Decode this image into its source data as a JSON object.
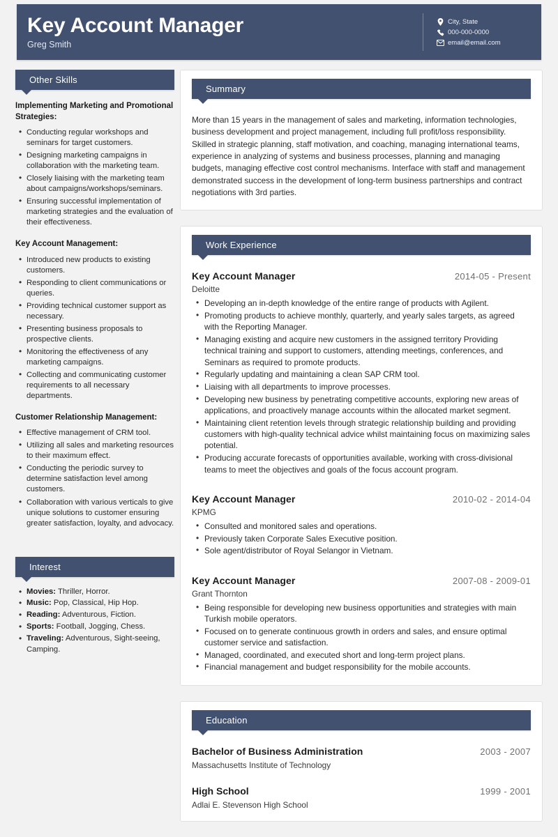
{
  "theme": {
    "accent": "#41516f",
    "page_bg": "#f2f2f2",
    "card_bg": "#ffffff"
  },
  "header": {
    "title": "Key Account Manager",
    "name": "Greg Smith",
    "contacts": [
      {
        "icon": "location-pin-icon",
        "text": "City, State"
      },
      {
        "icon": "phone-icon",
        "text": "000-000-0000"
      },
      {
        "icon": "envelope-icon",
        "text": "email@email.com"
      }
    ]
  },
  "sidebar": {
    "skills": {
      "heading": "Other Skills",
      "groups": [
        {
          "title": "Implementing Marketing and Promotional Strategies:",
          "items": [
            "Conducting regular workshops and seminars for target customers.",
            "Designing marketing campaigns in collaboration with the marketing team.",
            "Closely liaising with the marketing team about campaigns/workshops/seminars.",
            "Ensuring successful implementation of marketing strategies and the evaluation of their effectiveness."
          ]
        },
        {
          "title": "Key Account Management:",
          "items": [
            "Introduced new products to existing customers.",
            "Responding to client communications or queries.",
            "Providing technical customer support as necessary.",
            "Presenting business proposals to prospective clients.",
            "Monitoring the effectiveness of any marketing campaigns.",
            "Collecting and communicating customer requirements to all necessary departments."
          ]
        },
        {
          "title": "Customer Relationship Management:",
          "items": [
            "Effective management of CRM tool.",
            "Utilizing all sales and marketing resources to their maximum effect.",
            "Conducting the periodic survey to determine satisfaction level among customers.",
            "Collaboration with various verticals to give unique solutions to customer ensuring greater satisfaction, loyalty, and advocacy."
          ]
        }
      ]
    },
    "interest": {
      "heading": "Interest",
      "items": [
        {
          "label": "Movies:",
          "value": " Thriller, Horror."
        },
        {
          "label": "Music:",
          "value": " Pop, Classical, Hip Hop."
        },
        {
          "label": "Reading:",
          "value": " Adventurous, Fiction."
        },
        {
          "label": "Sports:",
          "value": " Football, Jogging, Chess."
        },
        {
          "label": "Traveling:",
          "value": " Adventurous, Sight-seeing, Camping."
        }
      ]
    }
  },
  "main": {
    "summary": {
      "heading": "Summary",
      "text": "More than 15 years in the management of sales and marketing, information technologies, business development and project management, including full profit/loss responsibility. Skilled in strategic planning, staff motivation, and coaching, managing international teams, experience in analyzing of systems and business processes, planning and managing budgets, managing effective cost control mechanisms. Interface with staff and management demonstrated success in the development of long-term business partnerships and contract negotiations with 3rd parties."
    },
    "work": {
      "heading": "Work Experience",
      "jobs": [
        {
          "title": "Key Account Manager",
          "dates": "2014-05 - Present",
          "company": "Deloitte",
          "bullets": [
            "Developing an in-depth knowledge of the entire range of products with Agilent.",
            "Promoting products to achieve monthly, quarterly, and yearly sales targets, as agreed with the Reporting Manager.",
            "Managing existing and acquire new customers in the assigned territory Providing technical training and support to customers, attending meetings, conferences, and Seminars as required to promote products.",
            "Regularly updating and maintaining a clean SAP CRM tool.",
            "Liaising with all departments to improve processes.",
            "Developing new business by penetrating competitive accounts, exploring new areas of applications, and proactively manage accounts within the allocated market segment.",
            "Maintaining client retention levels through strategic relationship building and providing customers with high-quality technical advice whilst maintaining focus on maximizing sales potential.",
            "Producing accurate forecasts of opportunities available, working with cross-divisional teams to meet the objectives and goals of the focus account program."
          ]
        },
        {
          "title": "Key Account Manager",
          "dates": "2010-02 - 2014-04",
          "company": "KPMG",
          "bullets": [
            "Consulted and monitored sales and operations.",
            "Previously taken Corporate Sales Executive position.",
            "Sole agent/distributor of Royal Selangor in Vietnam."
          ]
        },
        {
          "title": "Key Account Manager",
          "dates": "2007-08 - 2009-01",
          "company": "Grant Thornton",
          "bullets": [
            "Being responsible for developing new business opportunities and strategies with main Turkish mobile operators.",
            "Focused on to generate continuous growth in orders and sales, and ensure optimal customer service and satisfaction.",
            "Managed, coordinated, and executed short and long-term project plans.",
            "Financial management and budget responsibility for the mobile accounts."
          ]
        }
      ]
    },
    "education": {
      "heading": "Education",
      "entries": [
        {
          "degree": "Bachelor of Business Administration",
          "dates": "2003 - 2007",
          "school": "Massachusetts Institute of Technology"
        },
        {
          "degree": "High School",
          "dates": "1999 - 2001",
          "school": "Adlai E. Stevenson High School"
        }
      ]
    }
  }
}
